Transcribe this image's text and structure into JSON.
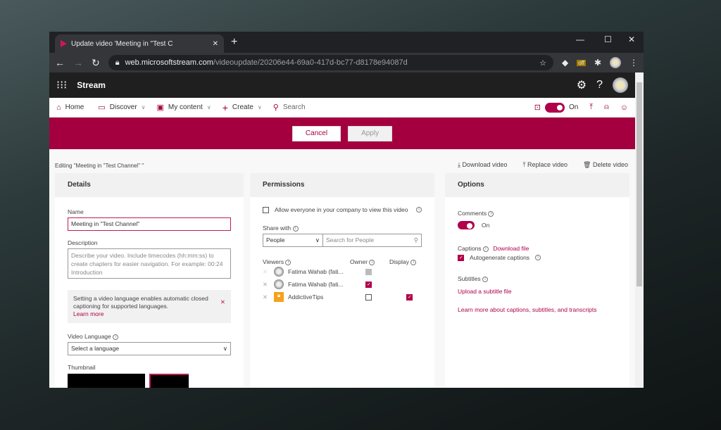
{
  "browser": {
    "tab_title": "Update video 'Meeting in \"Test C",
    "url_host": "web.microsoftstream.com",
    "url_path": "/videoupdate/20206e44-69a0-417d-bc77-d8178e94087d",
    "ext_badge": "off"
  },
  "app": {
    "title": "Stream"
  },
  "nav": {
    "home": "Home",
    "discover": "Discover",
    "my_content": "My content",
    "create": "Create",
    "search": "Search",
    "toggle_label": "On"
  },
  "actionbar": {
    "cancel": "Cancel",
    "apply": "Apply"
  },
  "editing": "Editing \"Meeting in \"Test Channel\" \"",
  "actions": {
    "download": "Download video",
    "replace": "Replace video",
    "delete": "Delete video"
  },
  "details": {
    "title": "Details",
    "name_label": "Name",
    "name_value": "Meeting in \"Test Channel\"",
    "desc_label": "Description",
    "desc_placeholder": "Describe your video. Include timecodes (hh:mm:ss) to create chapters for easier navigation. For example: 00:24 Introduction",
    "note": "Setting a video language enables automatic closed captioning for supported languages.",
    "note_link": "Learn more",
    "lang_label": "Video Language",
    "lang_value": "Select a language",
    "thumb_label": "Thumbnail"
  },
  "permissions": {
    "title": "Permissions",
    "allow": "Allow everyone in your company to view this video",
    "share_label": "Share with",
    "share_type": "People",
    "search_placeholder": "Search for People",
    "viewers_label": "Viewers",
    "owner_label": "Owner",
    "display_label": "Display",
    "viewers": [
      {
        "name": "Fatima Wahab (fati...",
        "owner": "disabled-checked",
        "display": false
      },
      {
        "name": "Fatima Wahab (fati...",
        "owner": true,
        "display": false
      },
      {
        "name": "AddictiveTips",
        "owner": false,
        "display": true
      }
    ]
  },
  "options": {
    "title": "Options",
    "comments_label": "Comments",
    "comments_state": "On",
    "captions_label": "Captions",
    "download_file": "Download file",
    "autogen": "Autogenerate captions",
    "subtitles_label": "Subtitles",
    "upload": "Upload a subtitle file",
    "learn": "Learn more about captions, subtitles, and transcripts"
  },
  "colors": {
    "accent": "#a4003f"
  }
}
